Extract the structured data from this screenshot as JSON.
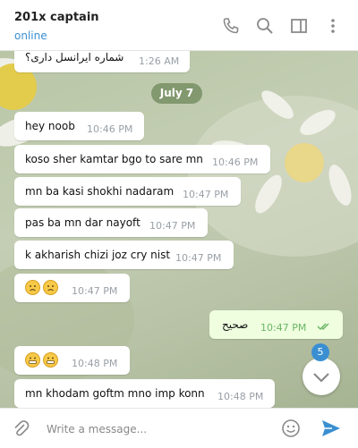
{
  "header": {
    "title": "201x captain",
    "status": "online"
  },
  "messages": [
    {
      "text": "شماره ایرانسل داری؟",
      "time": "1:26 AM"
    },
    {
      "text": "hey noob",
      "time": "10:46 PM"
    },
    {
      "text": "koso sher kamtar bgo to sare mn",
      "time": "10:46 PM"
    },
    {
      "text": "mn ba kasi shokhi nadaram",
      "time": "10:47 PM"
    },
    {
      "text": "pas ba mn dar nayoft",
      "time": "10:47 PM"
    },
    {
      "text": "k akharish chizi joz cry nist",
      "time": "10:47 PM"
    },
    {
      "text": "",
      "time": "10:47 PM"
    },
    {
      "text": "صحیح",
      "time": "10:47 PM"
    },
    {
      "text": "",
      "time": "10:48 PM"
    },
    {
      "text": "mn khodam goftm mno imp konn",
      "time": "10:48 PM"
    }
  ],
  "date_separator": "July 7",
  "unread_count": "5",
  "composer": {
    "placeholder": "Write a message..."
  },
  "colors": {
    "accent": "#3a8fd1",
    "outgoing_bubble": "#eefedf",
    "read_check": "#6db566"
  }
}
